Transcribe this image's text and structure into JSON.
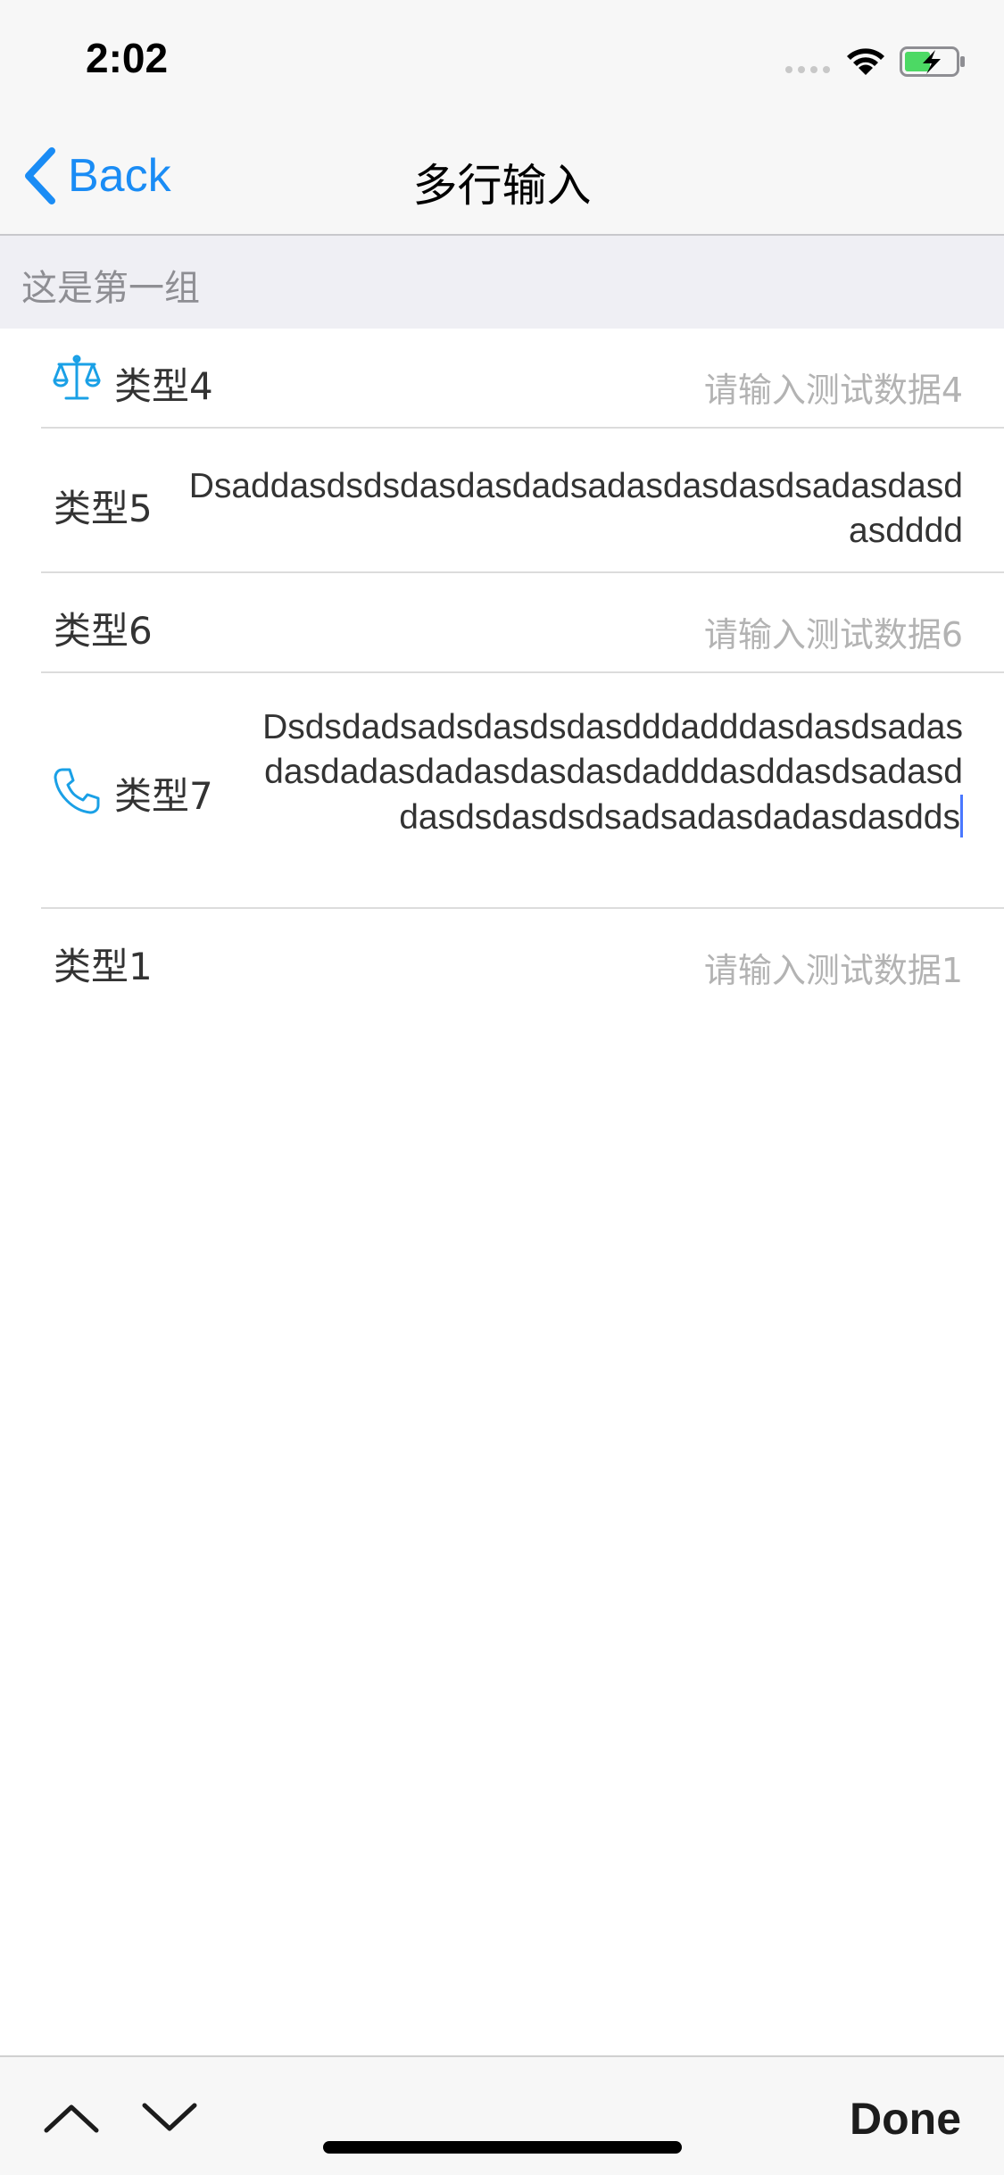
{
  "status_bar": {
    "time": "2:02"
  },
  "nav": {
    "back_label": "Back",
    "title": "多行输入"
  },
  "section": {
    "title": "这是第一组"
  },
  "rows": [
    {
      "label": "类型4",
      "icon": "scale-icon",
      "placeholder": "请输入测试数据4",
      "value": ""
    },
    {
      "label": "类型5",
      "icon": "",
      "placeholder": "",
      "value": "Dsaddasdsdsdasdasdadsadasdasdasdsadasdasdasdddd"
    },
    {
      "label": "类型6",
      "icon": "",
      "placeholder": "请输入测试数据6",
      "value": ""
    },
    {
      "label": "类型7",
      "icon": "phone-icon",
      "placeholder": "",
      "value": "Dsdsdadsadsdasdsdasdddadddasdasdsadasdasdadasdadasdasdasdadddasddasdsadasddasdsdasdsdsadsadasdadasdasdds"
    },
    {
      "label": "类型1",
      "icon": "",
      "placeholder": "请输入测试数据1",
      "value": ""
    }
  ],
  "toolbar": {
    "done_label": "Done"
  },
  "colors": {
    "accent": "#1a8cf5",
    "icon": "#1aa0e6",
    "placeholder": "#b3b3b3"
  }
}
